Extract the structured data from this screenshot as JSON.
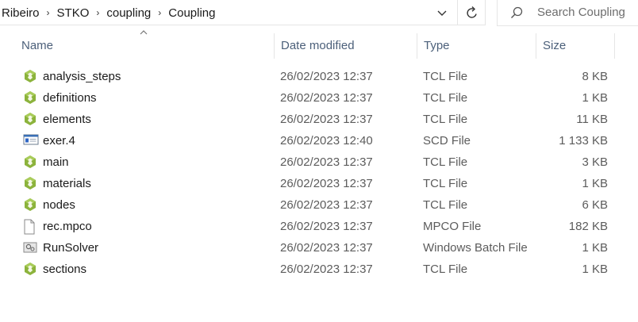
{
  "address": {
    "breadcrumbs": [
      "Ribeiro",
      "STKO",
      "coupling",
      "Coupling"
    ],
    "separator": "›"
  },
  "search": {
    "placeholder": "Search Coupling"
  },
  "columns": {
    "name": "Name",
    "date": "Date modified",
    "type": "Type",
    "size": "Size"
  },
  "sort": {
    "column": "name",
    "direction": "ascending"
  },
  "files": [
    {
      "name": "analysis_steps",
      "date": "26/02/2023 12:37",
      "type": "TCL File",
      "size": "8 KB",
      "icon": "tcl-file-icon"
    },
    {
      "name": "definitions",
      "date": "26/02/2023 12:37",
      "type": "TCL File",
      "size": "1 KB",
      "icon": "tcl-file-icon"
    },
    {
      "name": "elements",
      "date": "26/02/2023 12:37",
      "type": "TCL File",
      "size": "11 KB",
      "icon": "tcl-file-icon"
    },
    {
      "name": "exer.4",
      "date": "26/02/2023 12:40",
      "type": "SCD File",
      "size": "1 133 KB",
      "icon": "scd-file-icon"
    },
    {
      "name": "main",
      "date": "26/02/2023 12:37",
      "type": "TCL File",
      "size": "3 KB",
      "icon": "tcl-file-icon"
    },
    {
      "name": "materials",
      "date": "26/02/2023 12:37",
      "type": "TCL File",
      "size": "1 KB",
      "icon": "tcl-file-icon"
    },
    {
      "name": "nodes",
      "date": "26/02/2023 12:37",
      "type": "TCL File",
      "size": "6 KB",
      "icon": "tcl-file-icon"
    },
    {
      "name": "rec.mpco",
      "date": "26/02/2023 12:37",
      "type": "MPCO File",
      "size": "182 KB",
      "icon": "generic-file-icon"
    },
    {
      "name": "RunSolver",
      "date": "26/02/2023 12:37",
      "type": "Windows Batch File",
      "size": "1 KB",
      "icon": "batch-file-icon"
    },
    {
      "name": "sections",
      "date": "26/02/2023 12:37",
      "type": "TCL File",
      "size": "1 KB",
      "icon": "tcl-file-icon"
    }
  ],
  "colors": {
    "tcl_icon": "#8cb33c",
    "header_text": "#4c607a",
    "secondary_text": "#5c5c5c"
  }
}
